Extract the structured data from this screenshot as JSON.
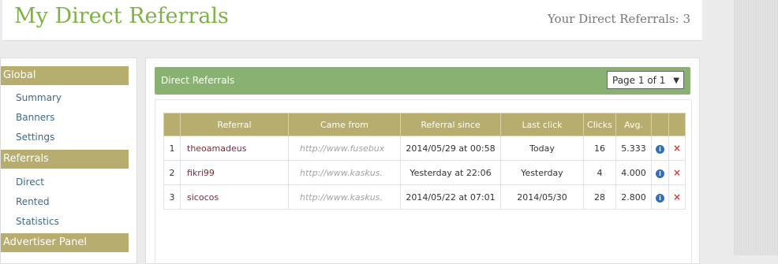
{
  "header": {
    "title": "My Direct Referrals",
    "count_text": "Your Direct Referrals: 3"
  },
  "sidebar": {
    "sections": [
      {
        "label": "Global",
        "items": [
          {
            "label": "Summary"
          },
          {
            "label": "Banners"
          },
          {
            "label": "Settings"
          }
        ]
      },
      {
        "label": "Referrals",
        "items": [
          {
            "label": "Direct"
          },
          {
            "label": "Rented"
          },
          {
            "label": "Statistics"
          }
        ]
      },
      {
        "label": "Advertiser Panel",
        "items": []
      }
    ]
  },
  "panel": {
    "title": "Direct Referrals",
    "pager": "Page 1 of 1",
    "pager_arrow_icon": "dropdown-arrow-icon"
  },
  "table": {
    "headers": [
      "",
      "Referral",
      "Came from",
      "Referral since",
      "Last click",
      "Clicks",
      "Avg.",
      "",
      ""
    ],
    "rows": [
      {
        "num": "1",
        "referral": "theoamadeus",
        "came_from": "http://www.fusebux",
        "since": "2014/05/29 at 00:58",
        "last_click": "Today",
        "clicks": "16",
        "avg": "5.333"
      },
      {
        "num": "2",
        "referral": "fikri99",
        "came_from": "http://www.kaskus.",
        "since": "Yesterday at 22:06",
        "last_click": "Yesterday",
        "clicks": "4",
        "avg": "4.000"
      },
      {
        "num": "3",
        "referral": "sicocos",
        "came_from": "http://www.kaskus.",
        "since": "2014/05/22 at 07:01",
        "last_click": "2014/05/30",
        "clicks": "28",
        "avg": "2.800"
      }
    ],
    "info_icon": "i",
    "delete_icon": "×"
  }
}
